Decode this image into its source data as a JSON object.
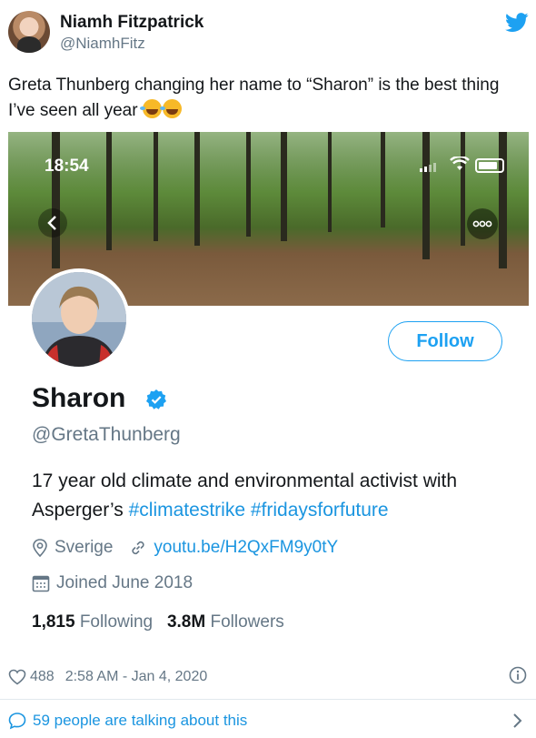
{
  "tweet": {
    "author_name": "Niamh Fitzpatrick",
    "author_handle": "@NiamhFitz",
    "text": "Greta Thunberg changing her name to “Sharon” is the best thing I’ve seen all year",
    "emoji_icon": "rolling-on-floor-laughing-emoji",
    "likes": "488",
    "timestamp": "2:58 AM - Jan 4, 2020",
    "talking": "59 people are talking about this"
  },
  "screenshot": {
    "status_time": "18:54",
    "profile": {
      "display_name": "Sharon",
      "handle": "@GretaThunberg",
      "bio_text": "17 year old climate and environmental activist with Asperger’s",
      "bio_hashtags": [
        "#climatestrike",
        "#fridaysforfuture"
      ],
      "location": "Sverige",
      "website": "youtu.be/H2QxFM9y0tY",
      "joined": "Joined June 2018",
      "following_count": "1,815",
      "following_label": "Following",
      "followers_count": "3.8M",
      "followers_label": "Followers",
      "follow_label": "Follow"
    }
  },
  "colors": {
    "accent": "#1da1f2",
    "link": "#1b95e0",
    "muted": "#657786",
    "text": "#14171a"
  }
}
